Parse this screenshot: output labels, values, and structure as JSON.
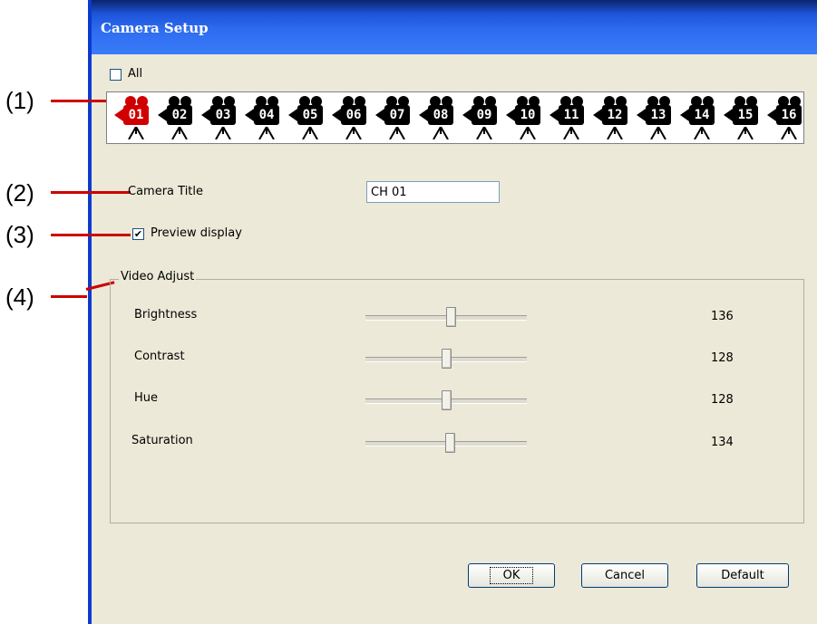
{
  "window": {
    "title": "Camera Setup"
  },
  "annotations": [
    "(1)",
    "(2)",
    "(3)",
    "(4)"
  ],
  "all_checkbox": {
    "label": "All",
    "checked": false
  },
  "cameras": [
    {
      "num": "01",
      "selected": true
    },
    {
      "num": "02",
      "selected": false
    },
    {
      "num": "03",
      "selected": false
    },
    {
      "num": "04",
      "selected": false
    },
    {
      "num": "05",
      "selected": false
    },
    {
      "num": "06",
      "selected": false
    },
    {
      "num": "07",
      "selected": false
    },
    {
      "num": "08",
      "selected": false
    },
    {
      "num": "09",
      "selected": false
    },
    {
      "num": "10",
      "selected": false
    },
    {
      "num": "11",
      "selected": false
    },
    {
      "num": "12",
      "selected": false
    },
    {
      "num": "13",
      "selected": false
    },
    {
      "num": "14",
      "selected": false
    },
    {
      "num": "15",
      "selected": false
    },
    {
      "num": "16",
      "selected": false
    }
  ],
  "camera_title": {
    "label": "Camera Title",
    "value": "CH 01"
  },
  "preview": {
    "label": "Preview display",
    "checked": true
  },
  "video_adjust": {
    "legend": "Video Adjust",
    "sliders": [
      {
        "label": "Brightness",
        "value": "136",
        "level": 136
      },
      {
        "label": "Contrast",
        "value": "128",
        "level": 128
      },
      {
        "label": "Hue",
        "value": "128",
        "level": 128
      },
      {
        "label": "Saturation",
        "value": "134",
        "level": 134
      }
    ]
  },
  "buttons": {
    "ok": "OK",
    "cancel": "Cancel",
    "default": "Default"
  },
  "colors": {
    "titlebar": "#2e6cf0",
    "annotation_line": "#cc0000",
    "selected_camera": "#d10000",
    "dialog_bg": "#ece9d8"
  }
}
